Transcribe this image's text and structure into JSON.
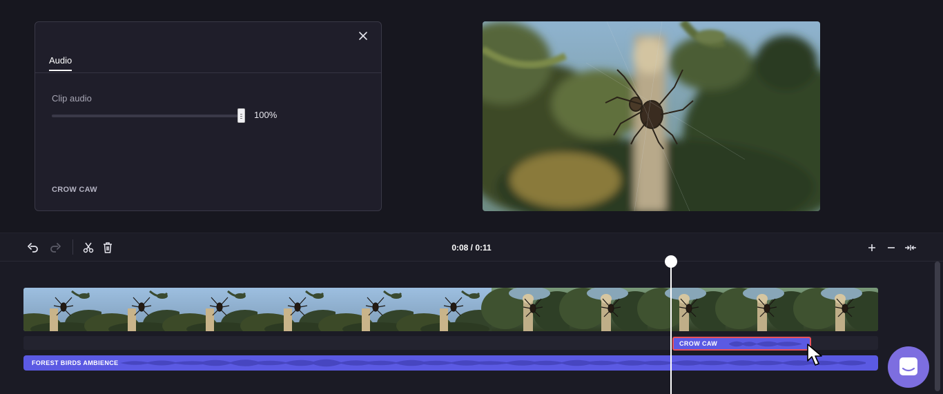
{
  "panel": {
    "tab_audio": "Audio",
    "clip_audio_label": "Clip audio",
    "volume_value": "100%",
    "volume_level": 1.0,
    "clip_name": "CROW CAW"
  },
  "toolbar": {
    "timecode": "0:08 / 0:11"
  },
  "timeline": {
    "audio_track_name": "FOREST BIRDS AMBIENCE",
    "crow_clip_name": "CROW CAW",
    "playhead_time": "0:08",
    "duration": "0:11"
  },
  "colors": {
    "accent": "#5b5ae3",
    "selection": "#e8515b",
    "chat": "#7d6ee0"
  },
  "icons": [
    "close-icon",
    "undo-icon",
    "redo-icon",
    "split-icon",
    "delete-icon",
    "zoom-in-icon",
    "zoom-out-icon",
    "fit-icon",
    "chat-icon"
  ]
}
